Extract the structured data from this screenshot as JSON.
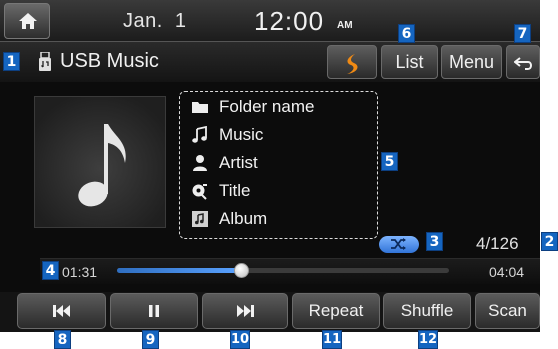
{
  "status_bar": {
    "date": "Jan.  1",
    "time": "12:00",
    "ampm": "AM"
  },
  "title_bar": {
    "source": "USB Music",
    "list_label": "List",
    "menu_label": "Menu"
  },
  "info": {
    "folder": "Folder name",
    "music": "Music",
    "artist": "Artist",
    "title": "Title",
    "album": "Album"
  },
  "playback": {
    "track_count": "4/126",
    "current_time": "01:31",
    "total_time": "04:04",
    "progress_fraction": 0.372
  },
  "controls": {
    "repeat_label": "Repeat",
    "shuffle_label": "Shuffle",
    "scan_label": "Scan"
  },
  "callouts": [
    "1",
    "2",
    "3",
    "4",
    "5",
    "6",
    "7",
    "8",
    "9",
    "10",
    "11",
    "12"
  ],
  "colors": {
    "accent_blue": "#1565c0",
    "shuffle_pill": "#3274d8",
    "progress_fill": "#5aa2ff"
  },
  "icons": [
    "home-icon",
    "usb-icon",
    "source-logo-icon",
    "back-icon",
    "music-note-icon",
    "folder-icon",
    "note-icon",
    "artist-icon",
    "title-icon",
    "album-icon",
    "shuffle-icon",
    "previous-track-icon",
    "pause-icon",
    "next-track-icon"
  ]
}
